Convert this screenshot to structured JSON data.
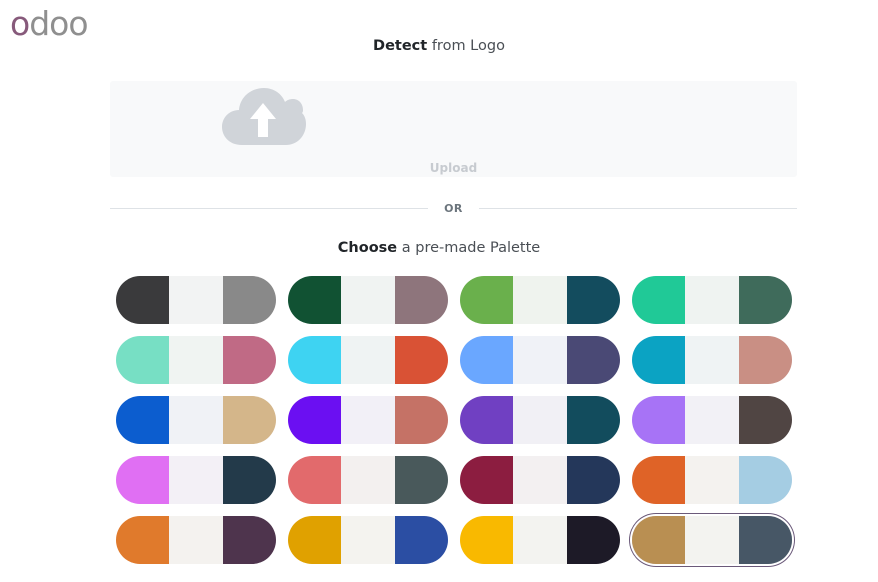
{
  "logo": {
    "text": "odoo",
    "brand_color": "#875A7B",
    "gray_color": "#8F8F8F"
  },
  "detect": {
    "bold": "Detect",
    "rest": " from Logo"
  },
  "upload": {
    "label": "Upload",
    "icon": "cloud-upload-icon"
  },
  "divider": {
    "label": "OR"
  },
  "choose": {
    "bold": "Choose",
    "rest": " a pre-made Palette"
  },
  "palettes": [
    [
      "#3A3A3C",
      "#F2F3F3",
      "#898989"
    ],
    [
      "#115233",
      "#F0F3F2",
      "#8E757C"
    ],
    [
      "#6AB04C",
      "#EFF3EE",
      "#134C5E"
    ],
    [
      "#20C997",
      "#EFF3F1",
      "#3F6B5B"
    ],
    [
      "#77DFC4",
      "#F0F4F2",
      "#C06A85"
    ],
    [
      "#3ED3F2",
      "#EFF3F3",
      "#D95235"
    ],
    [
      "#6AA7FF",
      "#F0F2F7",
      "#4A4975"
    ],
    [
      "#0BA3C3",
      "#EFF3F4",
      "#C98F84"
    ],
    [
      "#0C5DCF",
      "#F0F2F6",
      "#D4B68A"
    ],
    [
      "#6B0FF2",
      "#F2F0F7",
      "#C57266"
    ],
    [
      "#7040C2",
      "#F1F0F5",
      "#124C5D"
    ],
    [
      "#A773F6",
      "#F2F1F6",
      "#504543"
    ],
    [
      "#E06FF3",
      "#F3F0F6",
      "#233A4A"
    ],
    [
      "#E26A6C",
      "#F3F0EF",
      "#49595B"
    ],
    [
      "#8C1D40",
      "#F3F0F1",
      "#24375A"
    ],
    [
      "#DF6327",
      "#F4F2EF",
      "#A5CDE3"
    ],
    [
      "#E07A2C",
      "#F4F2EF",
      "#4E344D"
    ],
    [
      "#E0A100",
      "#F4F3EF",
      "#2B4EA3"
    ],
    [
      "#F9B900",
      "#F3F3F0",
      "#1D1A27"
    ],
    [
      "#B98F52",
      "#F3F3F0",
      "#475766"
    ]
  ],
  "selected_palette_index": 19
}
